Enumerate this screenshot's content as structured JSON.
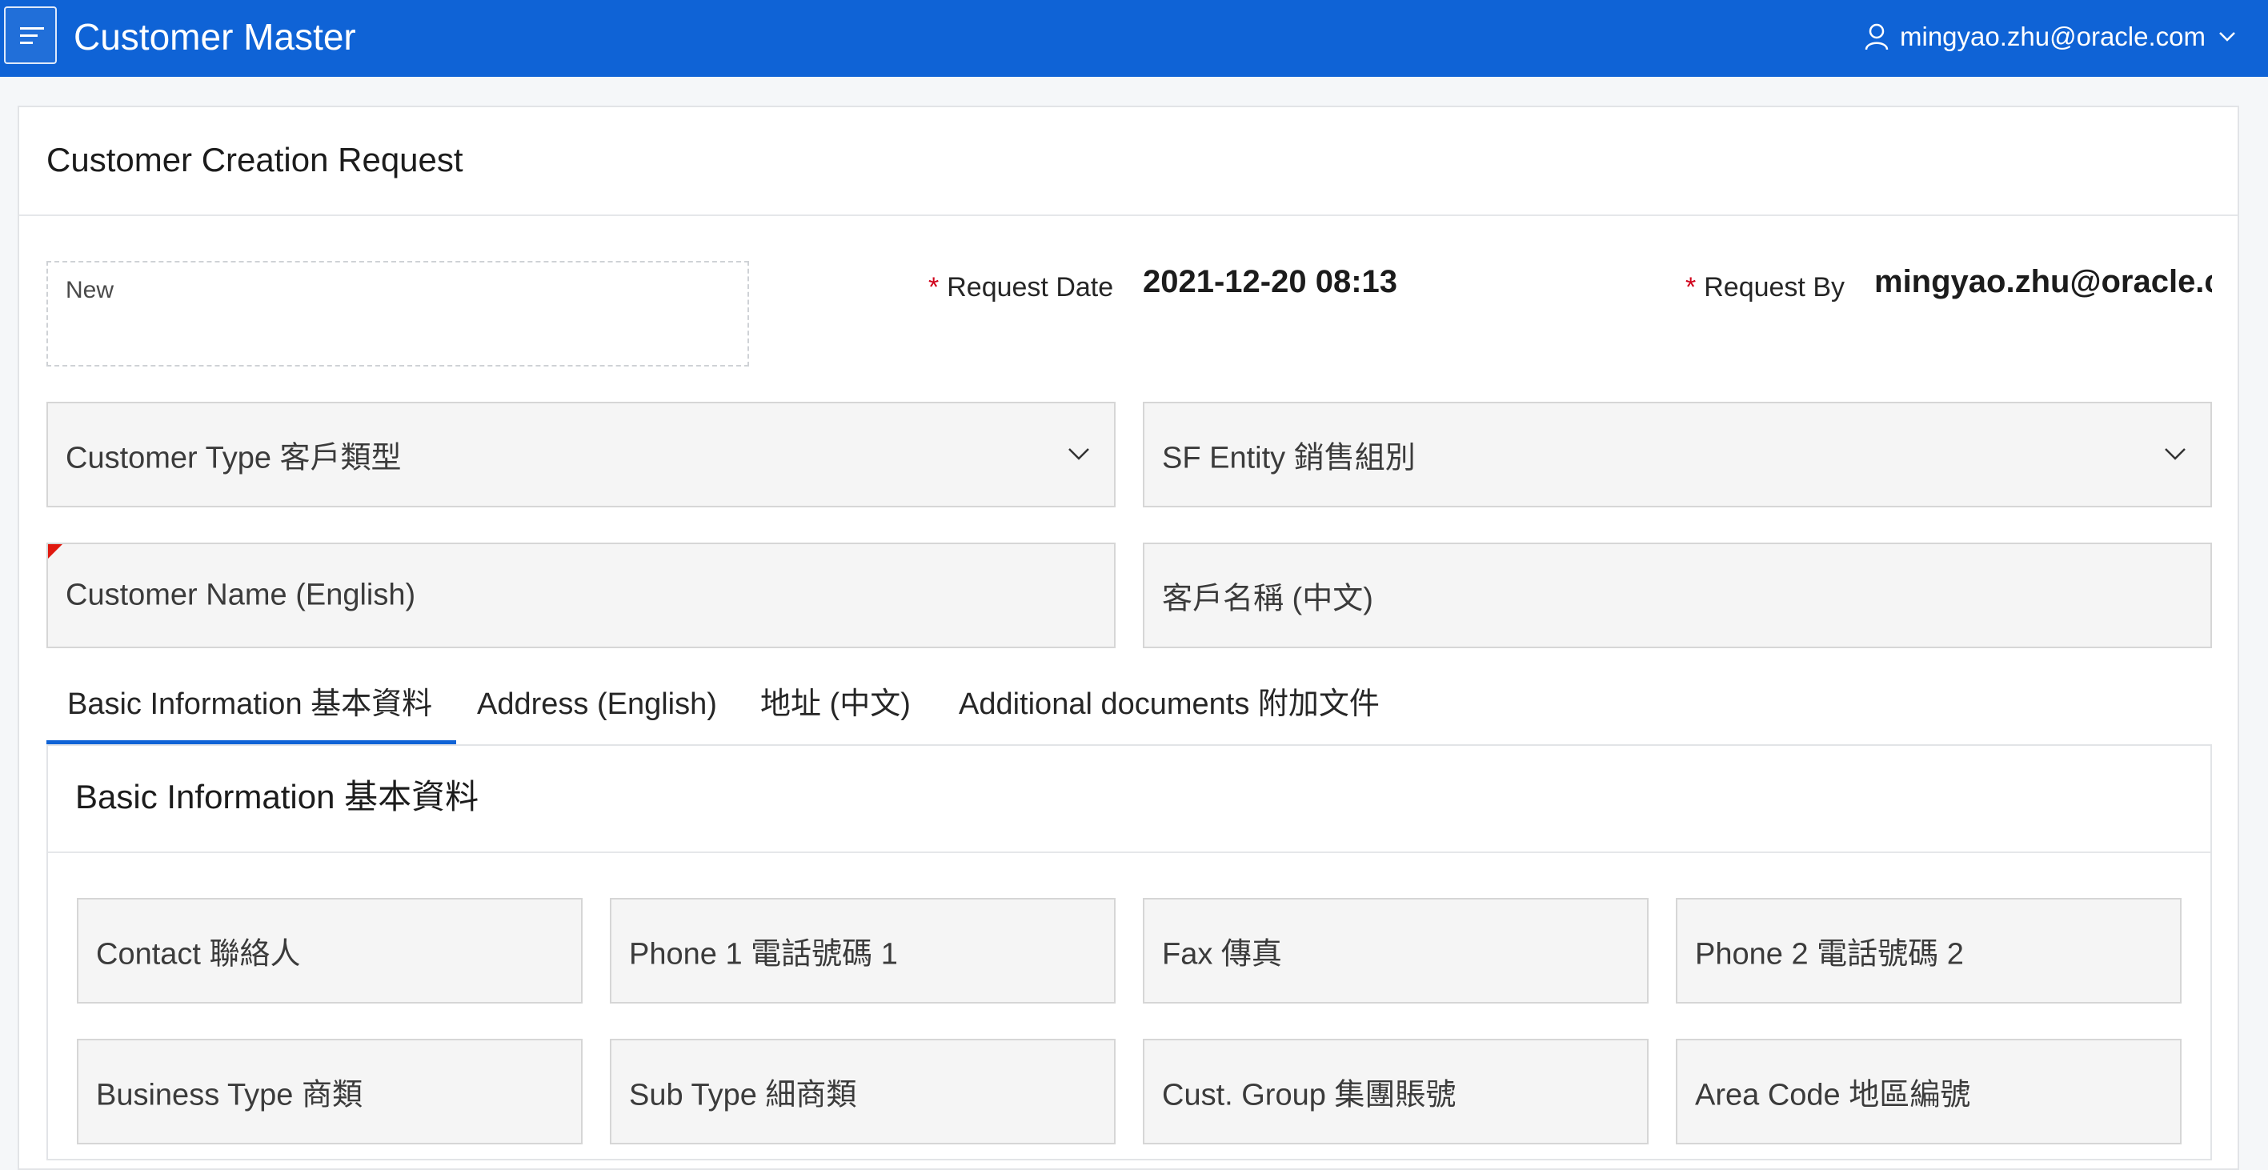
{
  "header": {
    "app_title": "Customer Master",
    "user_label": "mingyao.zhu@oracle.com"
  },
  "region": {
    "title": "Customer Creation Request",
    "status_value": "New",
    "request_date_label": "Request Date",
    "request_date_value": "2021-12-20 08:13",
    "request_by_label": "Request By",
    "request_by_value": "mingyao.zhu@oracle.com",
    "required_marker": "*"
  },
  "form": {
    "customer_type": "Customer Type 客戶類型",
    "sf_entity": "SF Entity 銷售組別",
    "customer_name_en": "Customer Name (English)",
    "customer_name_zh": "客戶名稱 (中文)"
  },
  "tabs": [
    {
      "label": "Basic Information 基本資料",
      "active": true
    },
    {
      "label": "Address (English)",
      "active": false
    },
    {
      "label": "地址 (中文)",
      "active": false
    },
    {
      "label": "Additional documents 附加文件",
      "active": false
    }
  ],
  "basic_info": {
    "title": "Basic Information 基本資料",
    "fields": [
      "Contact 聯絡人",
      "Phone 1 電話號碼 1",
      "Fax 傳真",
      "Phone 2 電話號碼 2",
      "Business Type 商類",
      "Sub Type 細商類",
      "Cust. Group 集團賬號",
      "Area Code 地區編號"
    ]
  },
  "colors": {
    "header_bg": "#0f63d6",
    "tab_active": "#0f63d6",
    "required": "#d0021b"
  }
}
